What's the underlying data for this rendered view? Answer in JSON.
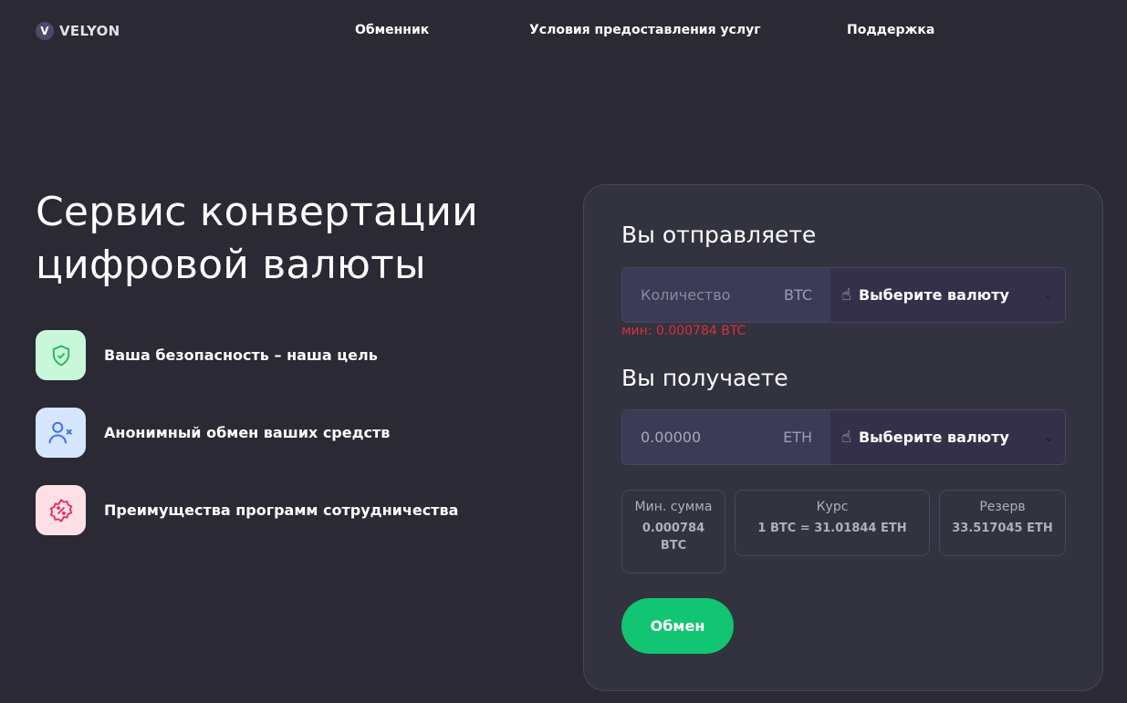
{
  "brand": {
    "mark": "V",
    "name": "VELYON"
  },
  "nav": [
    "Обменник",
    "Условия предоставления услуг",
    "Поддержка"
  ],
  "hero": {
    "title": "Сервис конвертации цифровой валюты"
  },
  "features": [
    {
      "icon": "shield-check-icon",
      "label": "Ваша безопасность – наша цель",
      "bg": "#c8f7d9",
      "fg": "#22b85b"
    },
    {
      "icon": "user-x-icon",
      "label": "Анонимный обмен ваших средств",
      "bg": "#d6e6ff",
      "fg": "#3c74f0"
    },
    {
      "icon": "discount-badge-icon",
      "label": "Преимущества программ сотрудничества",
      "bg": "#ffe0e6",
      "fg": "#f0285a"
    }
  ],
  "send": {
    "label": "Вы отправляете",
    "placeholder": "Количество",
    "currency": "BTC",
    "select": "Выберите валюту",
    "min": "мин: 0.000784 BTC"
  },
  "receive": {
    "label": "Вы получаете",
    "value": "0.00000",
    "currency": "ETH",
    "select": "Выберите валюту"
  },
  "info": {
    "min_label": "Мин. сумма",
    "min_value": "0.000784 BTC",
    "rate_label": "Курс",
    "rate_value": "1 BTC = 31.01844 ETH",
    "reserve_label": "Резерв",
    "reserve_value": "33.517045 ETH"
  },
  "exchange_button": "Обмен"
}
